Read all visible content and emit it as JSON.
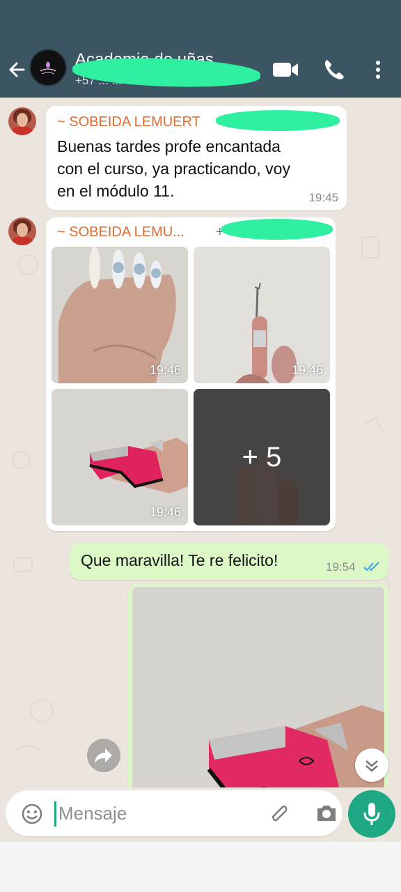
{
  "header": {
    "title": "Academia de uñas",
    "subtitle": "+57 ... ...",
    "back_icon": "arrow-left-icon",
    "icons": [
      "video-call-icon",
      "voice-call-icon",
      "more-vertical-icon"
    ],
    "colors": {
      "bar": "#3b5563",
      "redaction": "#2ef0a0"
    }
  },
  "messages": [
    {
      "sender": "~ SOBEIDA LEMUERT",
      "lines": [
        "Buenas tardes profe encantada",
        "con el curso, ya practicando, voy",
        "en el módulo 11."
      ],
      "time": "19:45"
    },
    {
      "sender": "~ SOBEIDA LEMU...",
      "sender_extra": "+",
      "photos": [
        {
          "time": "19:46",
          "subject": "hand with nails"
        },
        {
          "time": "19:46",
          "subject": "cuticle pusher on finger"
        },
        {
          "time": "19:46",
          "subject": "finger with nail form"
        },
        {
          "more_label": "+ 5",
          "subject": "finger"
        }
      ]
    },
    {
      "outgoing": true,
      "text": "Que maravilla! Te re felicito!",
      "time": "19:54",
      "status": "read-double-check-icon"
    }
  ],
  "composer": {
    "placeholder": "Mensaje",
    "icons": [
      "emoji-icon",
      "attach-clip-icon",
      "camera-icon",
      "mic-icon"
    ]
  }
}
